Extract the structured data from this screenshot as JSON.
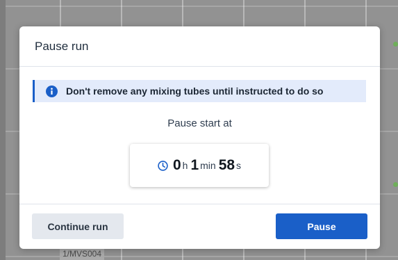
{
  "background": {
    "cell_label": "1/MVS004"
  },
  "dialog": {
    "title": "Pause run",
    "info_message": "Don't remove any mixing tubes until instructed to do so",
    "pause_label": "Pause start at",
    "timer": {
      "hours": "0",
      "hours_unit": "h",
      "minutes": "1",
      "minutes_unit": "min",
      "seconds": "58",
      "seconds_unit": "s"
    },
    "buttons": {
      "continue_label": "Continue run",
      "pause_label": "Pause"
    }
  },
  "icons": {
    "info": "info-icon",
    "clock": "clock-icon"
  },
  "colors": {
    "accent": "#1a5fc8",
    "banner_bg": "#e3ebfb",
    "secondary_button": "#e4e8ee",
    "overlay": "#929292"
  }
}
